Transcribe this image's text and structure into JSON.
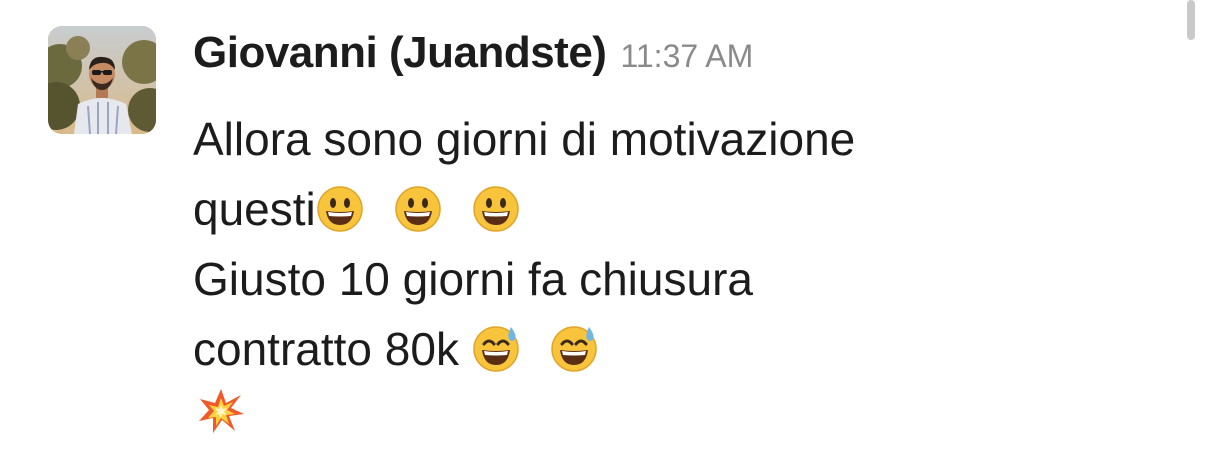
{
  "message": {
    "sender": "Giovanni (Juandste)",
    "timestamp": "11:37 AM",
    "lines": [
      {
        "text": "Allora sono giorni di motivazione"
      },
      {
        "text": "questi",
        "emojis": [
          "grinning-face-icon",
          "grinning-face-icon",
          "grinning-face-icon"
        ]
      },
      {
        "text": "Giusto 10 giorni fa chiusura"
      },
      {
        "text": "contratto 80k ",
        "emojis": [
          "grinning-sweat-face-icon",
          "grinning-sweat-face-icon"
        ]
      },
      {
        "text": "",
        "emojis": [
          "collision-icon"
        ]
      }
    ]
  },
  "colors": {
    "text": "#1d1c1d",
    "timestamp": "#8a8a8a",
    "scrollbar": "#c9c9c9",
    "emoji_face": "#f7c43c"
  }
}
